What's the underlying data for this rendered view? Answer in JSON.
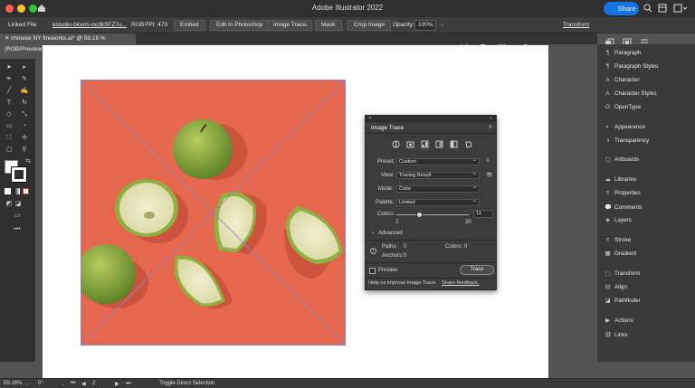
{
  "window": {
    "title": "Adobe Illustrator 2022",
    "share_label": "Share"
  },
  "control_bar": {
    "linked_file": "Linked File",
    "filename": "estudio-bloom-oo3kSFZ7u...",
    "color_mode": "RGB",
    "ppi": "PPI: 473",
    "embed": "Embed",
    "edit_in_photoshop": "Edit In Photoshop",
    "image_trace": "Image Trace",
    "mask": "Mask",
    "crop_image": "Crop Image",
    "opacity_label": "Opacity:",
    "opacity_value": "100%",
    "transform": "Transform"
  },
  "document_tab": {
    "label": "chinese NY fireworks.ai* @ 59.16 % (RGB/Preview)"
  },
  "right_panels": [
    "Paragraph",
    "Paragraph Styles",
    "Character",
    "Character Styles",
    "OpenType",
    "Appearance",
    "Transparency",
    "Artboards",
    "Libraries",
    "Properties",
    "Comments",
    "Layers",
    "Stroke",
    "Gradient",
    "Transform",
    "Align",
    "Pathfinder",
    "Actions",
    "Links"
  ],
  "image_trace_panel": {
    "title": "Image Trace",
    "preset_label": "Preset:",
    "preset_value": "Custom",
    "view_label": "View:",
    "view_value": "Tracing Result",
    "mode_label": "Mode:",
    "mode_value": "Color",
    "palette_label": "Palette:",
    "palette_value": "Limited",
    "colors_label": "Colors:",
    "colors_value": "11",
    "colors_min": "2",
    "colors_max": "30",
    "colors_fraction": 0.32,
    "advanced_label": "Advanced",
    "paths_label": "Paths:",
    "paths_value": "0",
    "colors_stat_label": "Colors:",
    "colors_stat_value": "0",
    "anchors_label": "Anchors:",
    "anchors_value": "0",
    "preview_label": "Preview",
    "trace_label": "Trace",
    "help_text": "Help us improve Image Trace.",
    "feedback_link": "Share feedback."
  },
  "status_bar": {
    "zoom": "59.16%",
    "rotation": "0°",
    "artboard": "2",
    "hint": "Toggle Direct Selection"
  }
}
